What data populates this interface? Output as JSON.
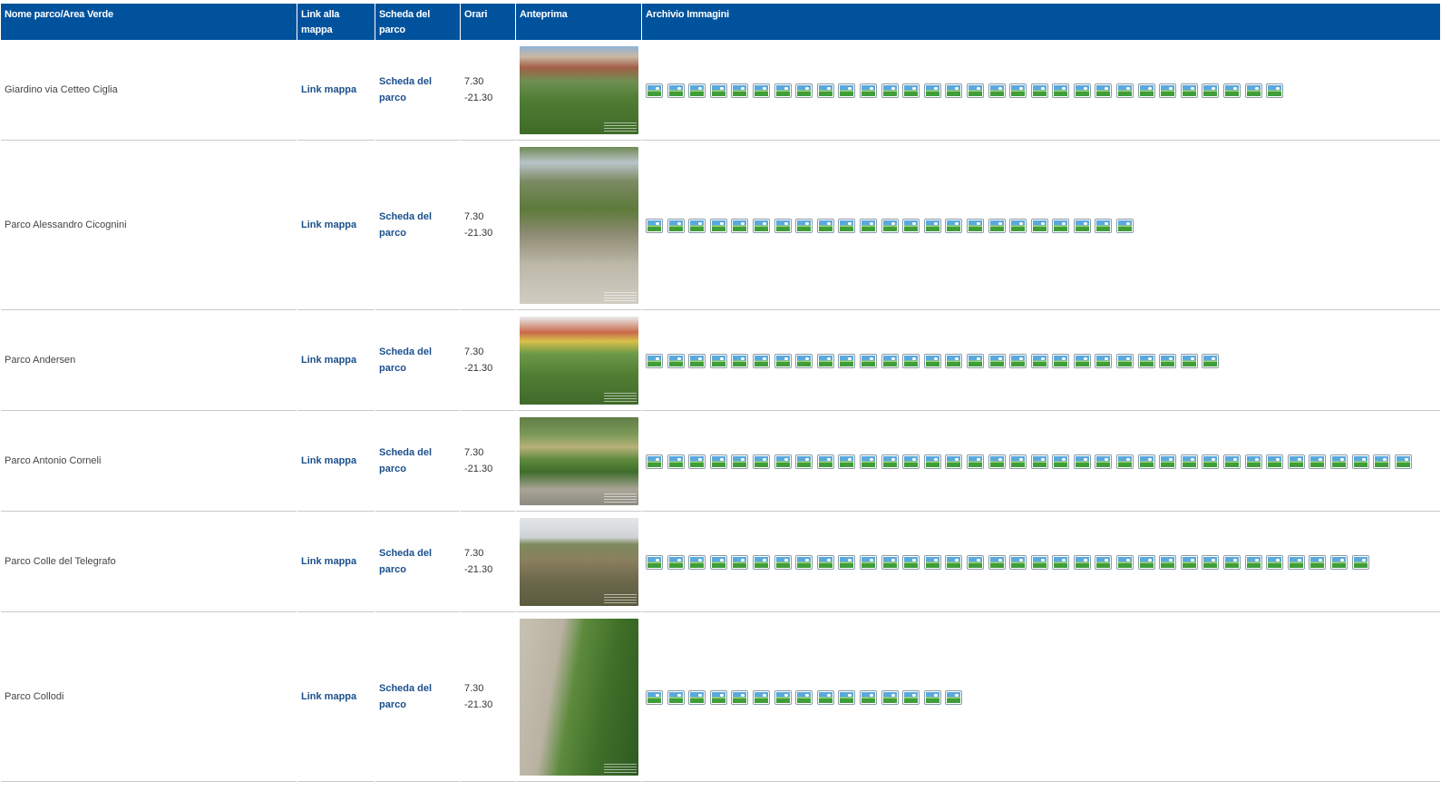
{
  "table": {
    "headers": {
      "name": "Nome parco/Area Verde",
      "map": "Link alla mappa",
      "sheet": "Scheda del parco",
      "hours": "Orari",
      "preview": "Anteprima",
      "archive": "Archivio Immagini"
    },
    "rows": [
      {
        "name": "Giardino via Cetteo Ciglia",
        "map_link": "Link mappa",
        "sheet_link": "Scheda del parco",
        "hours": "7.30 -21.30",
        "archive_image_count": 30
      },
      {
        "name": "Parco Alessandro Cicognini",
        "map_link": "Link mappa",
        "sheet_link": "Scheda del parco",
        "hours": "7.30 -21.30",
        "archive_image_count": 23
      },
      {
        "name": "Parco Andersen",
        "map_link": "Link mappa",
        "sheet_link": "Scheda del parco",
        "hours": "7.30 -21.30",
        "archive_image_count": 27
      },
      {
        "name": "Parco Antonio Corneli",
        "map_link": "Link mappa",
        "sheet_link": "Scheda del parco",
        "hours": "7.30 -21.30",
        "archive_image_count": 36
      },
      {
        "name": "Parco Colle del Telegrafo",
        "map_link": "Link mappa",
        "sheet_link": "Scheda del parco",
        "hours": "7.30 -21.30",
        "archive_image_count": 34
      },
      {
        "name": "Parco Collodi",
        "map_link": "Link mappa",
        "sheet_link": "Scheda del parco",
        "hours": "7.30 -21.30",
        "archive_image_count": 15
      }
    ]
  },
  "icons": {
    "archive_image": "broken-image-icon"
  },
  "colors": {
    "header_bg": "#00529c",
    "header_text": "#ffffff",
    "link": "#1a4f8c",
    "row_separator": "#c8c8c8"
  }
}
